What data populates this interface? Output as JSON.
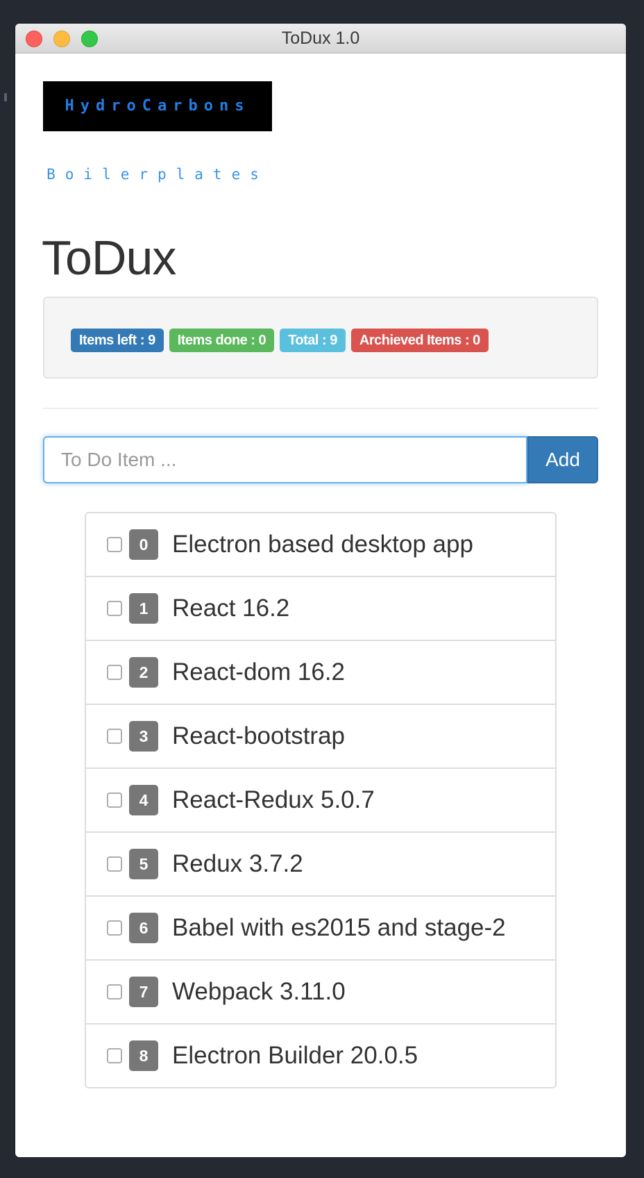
{
  "window": {
    "title": "ToDux 1.0"
  },
  "logo": {
    "text": "HydroCarbons",
    "subtitle": "Boilerplates"
  },
  "app": {
    "title": "ToDux"
  },
  "stats": {
    "items_left": "Items left : 9",
    "items_done": "Items done : 0",
    "total": "Total : 9",
    "archived": "Archieved Items : 0"
  },
  "input": {
    "placeholder": "To Do Item ...",
    "value": "",
    "add_label": "Add"
  },
  "colors": {
    "primary": "#337ab7",
    "success": "#5cb85c",
    "info": "#5bc0de",
    "danger": "#d9534f",
    "item_badge": "#777777",
    "logo_blue": "#1e7fe6"
  },
  "todos": [
    {
      "num": "0",
      "text": "Electron based desktop app",
      "done": false
    },
    {
      "num": "1",
      "text": "React 16.2",
      "done": false
    },
    {
      "num": "2",
      "text": "React-dom 16.2",
      "done": false
    },
    {
      "num": "3",
      "text": "React-bootstrap",
      "done": false
    },
    {
      "num": "4",
      "text": "React-Redux 5.0.7",
      "done": false
    },
    {
      "num": "5",
      "text": "Redux 3.7.2",
      "done": false
    },
    {
      "num": "6",
      "text": "Babel with es2015 and stage-2",
      "done": false
    },
    {
      "num": "7",
      "text": "Webpack 3.11.0",
      "done": false
    },
    {
      "num": "8",
      "text": "Electron Builder 20.0.5",
      "done": false
    }
  ]
}
